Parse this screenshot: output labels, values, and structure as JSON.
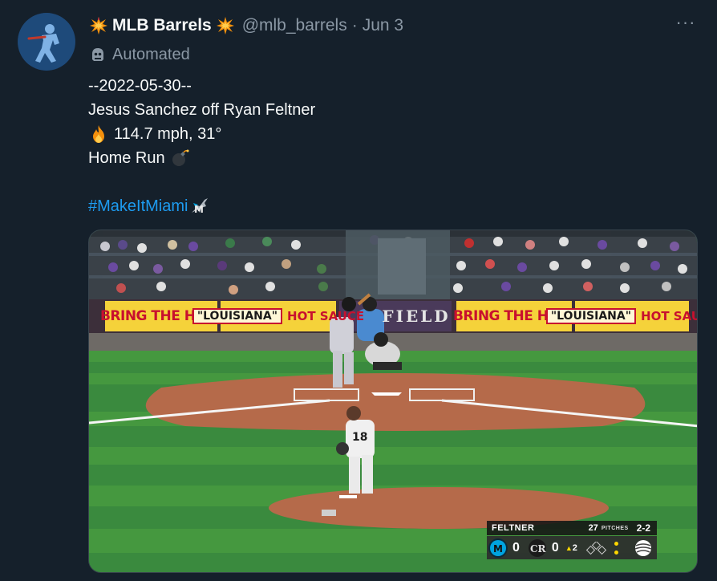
{
  "tweet": {
    "display_name": "MLB Barrels",
    "handle": "@mlb_barrels",
    "separator": "·",
    "date": "Jun 3",
    "more_label": "···",
    "automated_label": "Automated",
    "lines": {
      "date_line": "--2022-05-30--",
      "matchup": "Jesus Sanchez off Ryan Feltner",
      "stats": "114.7 mph, 31°",
      "result": "Home Run",
      "hashtag": "#MakeItMiami"
    },
    "icons": {
      "name_prefix": "collision-emoji-icon",
      "name_suffix": "collision-emoji-icon",
      "automated": "bot-icon",
      "stats": "fire-emoji-icon",
      "result": "bomb-emoji-icon",
      "hashtag": "marlins-logo-icon"
    }
  },
  "media": {
    "ads": {
      "bring_the_heat": "BRING THE HEAT",
      "louisiana": "\"LOUISIANA\"",
      "hot_sauce": "HOT SAUCE",
      "field": "FIELD"
    },
    "pitcher_number": "18",
    "pitcher_name": "FELTNER",
    "scorebug": {
      "pitcher": "FELTNER",
      "pitch_count": "27",
      "pitches_label": "PITCHES",
      "count": "2-2",
      "away_score": "0",
      "home_score": "0",
      "inning": "2",
      "outs": 2,
      "away_team": "marlins-logo-icon",
      "home_team": "rockies-logo-icon",
      "sponsor": "att-logo-icon"
    }
  },
  "colors": {
    "background": "#15202b",
    "primary_text": "#f7f9f9",
    "secondary_text": "#8b98a5",
    "link": "#1d9bf0",
    "border": "#38444d"
  }
}
